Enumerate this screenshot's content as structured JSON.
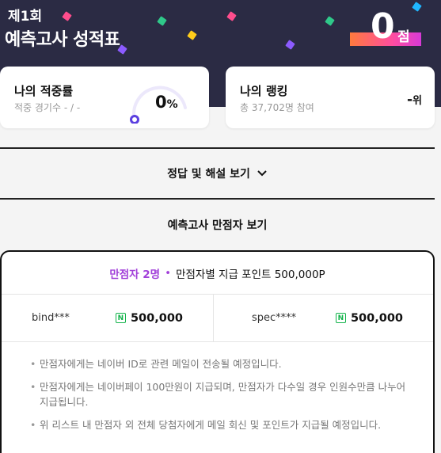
{
  "header": {
    "round": "제1회",
    "title": "예측고사 성적표",
    "score": "0",
    "score_unit": "점"
  },
  "accuracy": {
    "title": "나의 적중률",
    "sub": "적중 경기수 - / -",
    "value": "0",
    "unit": "%"
  },
  "ranking": {
    "title": "나의 랭킹",
    "sub": "총 37,702명 참여",
    "value": "-",
    "unit": "위"
  },
  "answer_button": {
    "label": "정답 및 해설 보기",
    "icon": "chevron-down-icon"
  },
  "perfect_section": {
    "title": "예측고사 만점자 보기"
  },
  "winners": {
    "count_label": "만점자 2명",
    "separator": "•",
    "point_info": "만점자별 지급 포인트 500,000P",
    "list": [
      {
        "name": "bind***",
        "points": "500,000"
      },
      {
        "name": "spec****",
        "points": "500,000"
      }
    ],
    "badge": "N",
    "notes": [
      "만점자에게는 네이버 ID로 관련 메일이 전송될 예정입니다.",
      "만점자에게는 네이버페이 100만원이 지급되며, 만점자가 다수일 경우 인원수만큼 나누어 지급됩니다.",
      "위 리스트 내 만점자 외 전체 당첨자에게 메일 회신 및 포인트가 지급될 예정입니다."
    ]
  },
  "colors": {
    "header_bg": "#2b2b44",
    "accent": "#a13fd9",
    "gauge": "#5b3fe0",
    "naver_green": "#12b34a"
  }
}
